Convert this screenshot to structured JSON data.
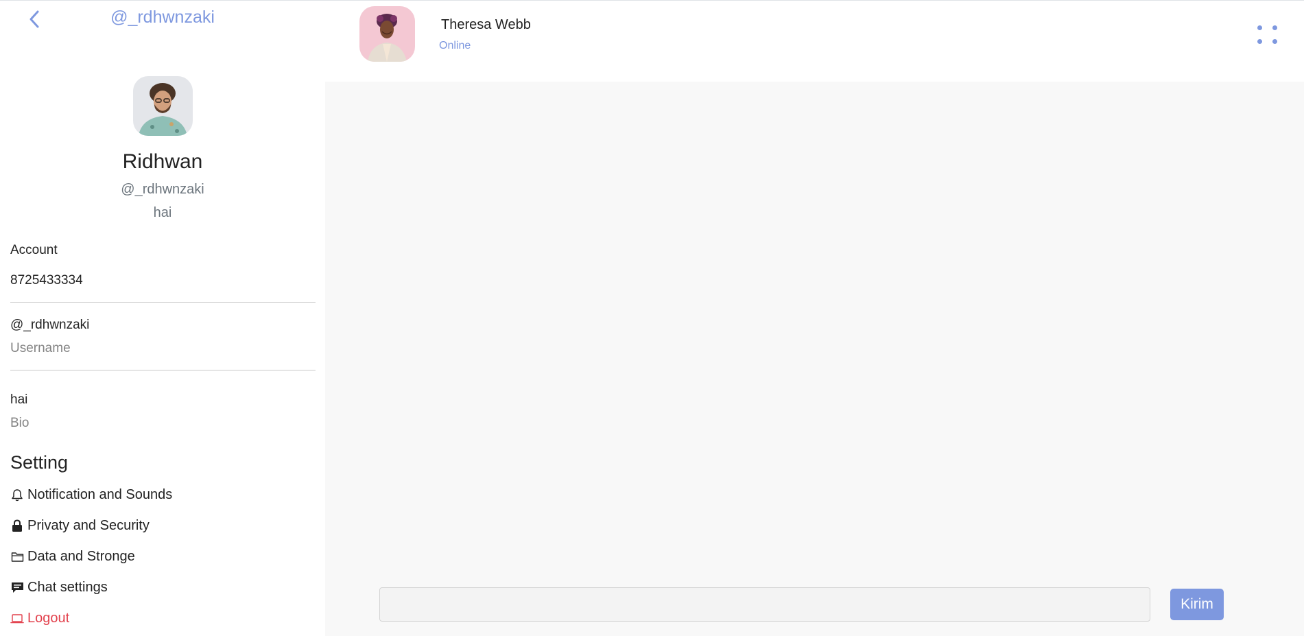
{
  "sidebar": {
    "top_handle": "@_rdhwnzaki",
    "back_icon": "chevron-left-icon",
    "profile": {
      "name": "Ridhwan",
      "handle": "@_rdhwnzaki",
      "bio": "hai"
    },
    "account": {
      "label": "Account",
      "phone": "8725433334",
      "username_value": "@_rdhwnzaki",
      "username_label": "Username",
      "bio_value": "hai",
      "bio_label": "Bio"
    },
    "setting": {
      "title": "Setting",
      "items": [
        {
          "label": "Notification and Sounds",
          "icon": "bell-icon"
        },
        {
          "label": "Privaty and Security",
          "icon": "lock-icon"
        },
        {
          "label": "Data and Stronge",
          "icon": "folder-icon"
        },
        {
          "label": "Chat settings",
          "icon": "chat-icon"
        },
        {
          "label": "Logout",
          "icon": "laptop-icon"
        }
      ]
    }
  },
  "chat": {
    "contact_name": "Theresa Webb",
    "contact_status": "Online",
    "menu_icon": "four-dots-icon",
    "input_value": "",
    "send_label": "Kirim"
  },
  "colors": {
    "accent": "#7e98df",
    "logout": "#e2404c",
    "chat_bg": "#f8f8f8"
  }
}
